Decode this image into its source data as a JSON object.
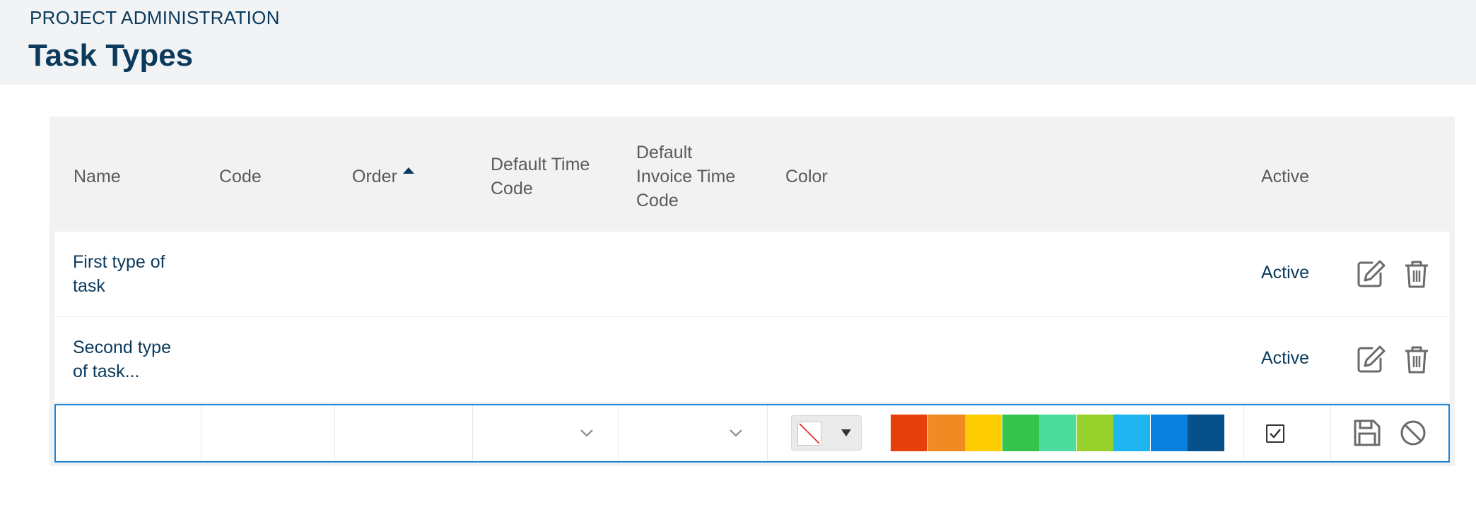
{
  "header": {
    "breadcrumb": "PROJECT ADMINISTRATION",
    "title": "Task Types"
  },
  "table": {
    "columns": {
      "name": "Name",
      "code": "Code",
      "order": "Order",
      "default_time_code": [
        "Default Time",
        "Code"
      ],
      "default_invoice_time_code": [
        "Default",
        "Invoice Time",
        "Code"
      ],
      "color": "Color",
      "active": "Active"
    },
    "sort": {
      "column": "Order",
      "direction": "ascending"
    },
    "rows": [
      {
        "name_lines": [
          "First type of",
          "task"
        ],
        "active": "Active"
      },
      {
        "name_lines": [
          "Second type",
          "of task..."
        ],
        "active": "Active"
      }
    ],
    "edit_row": {
      "name": "",
      "code": "",
      "order": "",
      "default_time_code": "",
      "default_invoice_time_code": "",
      "selected_color": "none",
      "active_checked": true,
      "palette": [
        "#e8400c",
        "#f18a22",
        "#fdcc00",
        "#34c44e",
        "#4bdc9e",
        "#96d22b",
        "#1fb5f0",
        "#0a80de",
        "#06508c"
      ]
    }
  },
  "icons": {
    "edit": "edit-icon",
    "delete": "trash-icon",
    "save": "save-icon",
    "cancel": "cancel-icon",
    "sort": "sort-ascending-icon",
    "dropdown": "chevron-down-icon"
  },
  "colors": {
    "accent": "#0b3a5c",
    "edit_border": "#1e87d8"
  }
}
